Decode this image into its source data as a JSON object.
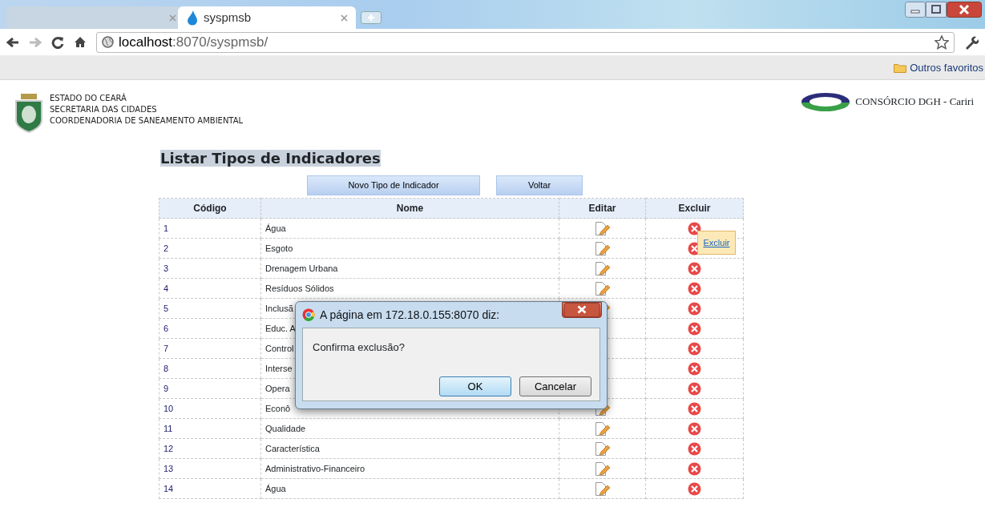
{
  "browser": {
    "tabs": [
      {
        "selected": false
      },
      {
        "title": "syspmsb",
        "selected": true
      }
    ],
    "address": {
      "host": "localhost",
      "path": ":8070/syspmsb/"
    },
    "bookmarks": [
      "Outros favoritos"
    ]
  },
  "header": {
    "org_lines": [
      "ESTADO DO CEARÁ",
      "SECRETARIA DAS CIDADES",
      "COORDENADORIA DE SANEAMENTO AMBIENTAL"
    ],
    "partner": "CONSÓRCIO DGH - Cariri"
  },
  "page_title": "Listar Tipos de Indicadores",
  "buttons": [
    "Novo Tipo de Indicador",
    "Voltar"
  ],
  "table": {
    "columns": [
      "Código",
      "Nome",
      "Editar",
      "Excluir"
    ],
    "rows": [
      {
        "code": "1",
        "name": "Água",
        "edit_icon": true
      },
      {
        "code": "2",
        "name": "Esgoto",
        "edit_icon": true
      },
      {
        "code": "3",
        "name": "Drenagem Urbana",
        "edit_icon": true
      },
      {
        "code": "4",
        "name": "Resíduos Sólidos",
        "edit_icon": true
      },
      {
        "code": "5",
        "name": "Inclusã",
        "edit_icon": true
      },
      {
        "code": "6",
        "name": "Educ. A",
        "edit_icon": false
      },
      {
        "code": "7",
        "name": "Control",
        "edit_icon": false
      },
      {
        "code": "8",
        "name": "Interse",
        "edit_icon": false
      },
      {
        "code": "9",
        "name": "Opera",
        "edit_icon": false
      },
      {
        "code": "10",
        "name": "Econô",
        "edit_icon": true
      },
      {
        "code": "11",
        "name": "Qualidade",
        "edit_icon": true
      },
      {
        "code": "12",
        "name": "Característica",
        "edit_icon": true
      },
      {
        "code": "13",
        "name": "Administrativo-Financeiro",
        "edit_icon": true
      },
      {
        "code": "14",
        "name": "Água",
        "edit_icon": true
      }
    ]
  },
  "tooltip": {
    "text": "Excluir"
  },
  "dialog": {
    "title": "A página em 172.18.0.155:8070 diz:",
    "message": "Confirma exclusão?",
    "buttons": [
      {
        "label": "OK",
        "selected": true
      },
      {
        "label": "Cancelar",
        "selected": false
      }
    ]
  }
}
